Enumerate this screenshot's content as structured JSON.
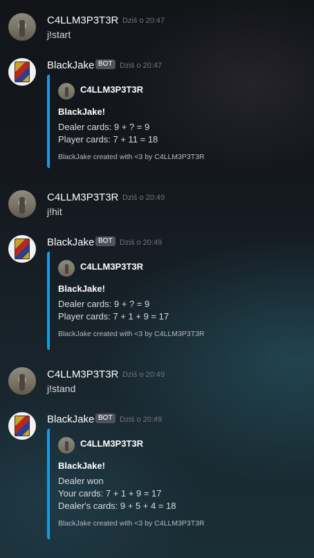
{
  "colors": {
    "embed_accent": "#1b9be0",
    "username": "#ffffff",
    "timestamp": "#72767d",
    "bot_tag_bg": "#4f545c"
  },
  "messages": [
    {
      "author": "C4LLM3P3T3R",
      "timestamp": "Dziś o 20:47",
      "text": "j!start",
      "avatar_icon": "user-avatar-photo"
    },
    {
      "author": "BlackJake",
      "bot_tag": "BOT",
      "timestamp": "Dziś o 20:47",
      "avatar_icon": "playing-card-king-avatar",
      "embed": {
        "author": "C4LLM3P3T3R",
        "title": "BlackJake!",
        "lines": [
          "Dealer cards: 9 + ? = 9",
          "Player cards: 7 + 11 = 18"
        ],
        "footer": "BlackJake created with <3 by C4LLM3P3T3R"
      }
    },
    {
      "author": "C4LLM3P3T3R",
      "timestamp": "Dziś o 20:49",
      "text": "j!hit",
      "avatar_icon": "user-avatar-photo"
    },
    {
      "author": "BlackJake",
      "bot_tag": "BOT",
      "timestamp": "Dziś o 20:49",
      "avatar_icon": "playing-card-king-avatar",
      "embed": {
        "author": "C4LLM3P3T3R",
        "title": "BlackJake!",
        "lines": [
          "Dealer cards: 9 + ? = 9",
          "Player cards: 7 + 1 + 9 = 17"
        ],
        "footer": "BlackJake created with <3 by C4LLM3P3T3R"
      }
    },
    {
      "author": "C4LLM3P3T3R",
      "timestamp": "Dziś o 20:49",
      "text": "j!stand",
      "avatar_icon": "user-avatar-photo"
    },
    {
      "author": "BlackJake",
      "bot_tag": "BOT",
      "timestamp": "Dziś o 20:49",
      "avatar_icon": "playing-card-king-avatar",
      "embed": {
        "author": "C4LLM3P3T3R",
        "title": "BlackJake!",
        "lines": [
          "Dealer won",
          "Your cards: 7 + 1 + 9 = 17",
          "Dealer's cards: 9 + 5 + 4 = 18"
        ],
        "footer": "BlackJake created with <3 by C4LLM3P3T3R"
      }
    }
  ]
}
